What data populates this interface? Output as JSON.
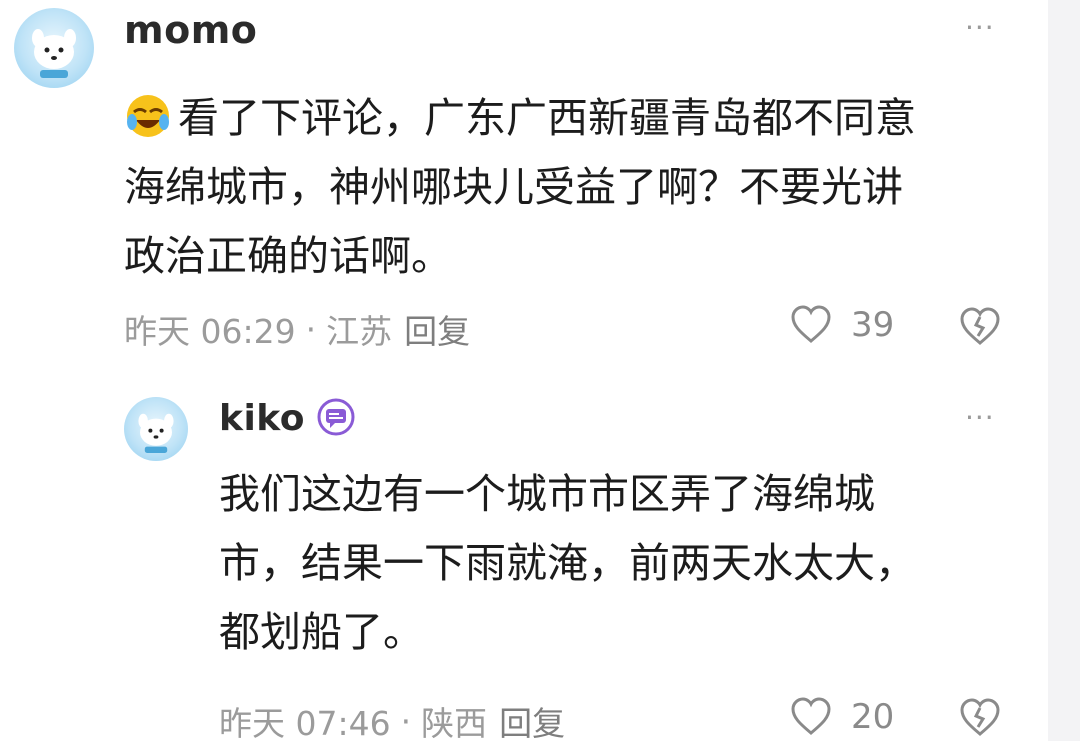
{
  "comments": [
    {
      "username": "momo",
      "text": "看了下评论，广东广西新疆青岛都不同意海绵城市，神州哪块儿受益了啊？不要光讲政治正确的话啊。",
      "lines": [
        "看了下评论，广东广西新疆青岛都不同意",
        "海绵城市，神州哪块儿受益了啊？不要光讲",
        "政治正确的话啊。"
      ],
      "emoji": "laughing-crying-emoji",
      "time": "昨天 06:29",
      "separator": "·",
      "location": "江苏",
      "reply_label": "回复",
      "likes": "39",
      "more": "···"
    },
    {
      "username": "kiko",
      "badge": "message-badge-icon",
      "lines": [
        "我们这边有一个城市市区弄了海绵城",
        "市，结果一下雨就淹，前两天水太大，",
        "都划船了。"
      ],
      "time": "昨天 07:46",
      "separator": "·",
      "location": "陕西",
      "reply_label": "回复",
      "likes": "20",
      "more": "···"
    }
  ],
  "colors": {
    "text": "#1c1c1c",
    "meta": "#9b9b9b",
    "badge": "#8a5bd6",
    "avatar": "#8fcdef"
  }
}
